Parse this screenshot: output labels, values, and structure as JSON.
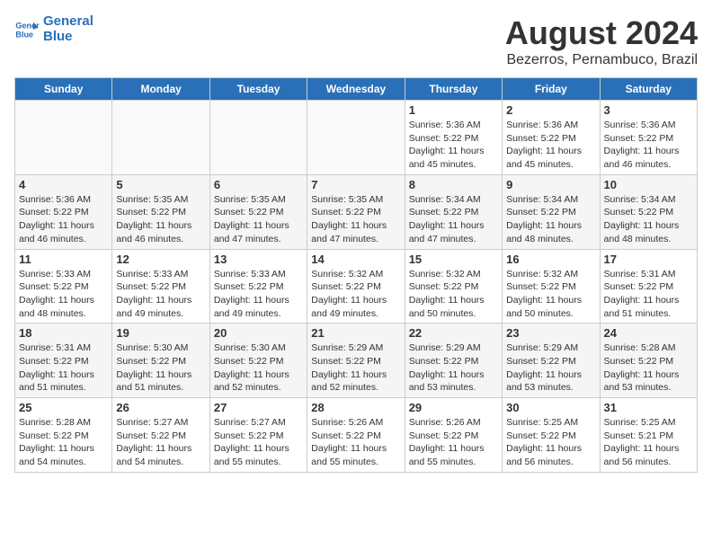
{
  "logo": {
    "line1": "General",
    "line2": "Blue"
  },
  "title": "August 2024",
  "subtitle": "Bezerros, Pernambuco, Brazil",
  "weekdays": [
    "Sunday",
    "Monday",
    "Tuesday",
    "Wednesday",
    "Thursday",
    "Friday",
    "Saturday"
  ],
  "weeks": [
    [
      {
        "day": "",
        "detail": "",
        "empty": true
      },
      {
        "day": "",
        "detail": "",
        "empty": true
      },
      {
        "day": "",
        "detail": "",
        "empty": true
      },
      {
        "day": "",
        "detail": "",
        "empty": true
      },
      {
        "day": "1",
        "detail": "Sunrise: 5:36 AM\nSunset: 5:22 PM\nDaylight: 11 hours\nand 45 minutes."
      },
      {
        "day": "2",
        "detail": "Sunrise: 5:36 AM\nSunset: 5:22 PM\nDaylight: 11 hours\nand 45 minutes."
      },
      {
        "day": "3",
        "detail": "Sunrise: 5:36 AM\nSunset: 5:22 PM\nDaylight: 11 hours\nand 46 minutes."
      }
    ],
    [
      {
        "day": "4",
        "detail": "Sunrise: 5:36 AM\nSunset: 5:22 PM\nDaylight: 11 hours\nand 46 minutes."
      },
      {
        "day": "5",
        "detail": "Sunrise: 5:35 AM\nSunset: 5:22 PM\nDaylight: 11 hours\nand 46 minutes."
      },
      {
        "day": "6",
        "detail": "Sunrise: 5:35 AM\nSunset: 5:22 PM\nDaylight: 11 hours\nand 47 minutes."
      },
      {
        "day": "7",
        "detail": "Sunrise: 5:35 AM\nSunset: 5:22 PM\nDaylight: 11 hours\nand 47 minutes."
      },
      {
        "day": "8",
        "detail": "Sunrise: 5:34 AM\nSunset: 5:22 PM\nDaylight: 11 hours\nand 47 minutes."
      },
      {
        "day": "9",
        "detail": "Sunrise: 5:34 AM\nSunset: 5:22 PM\nDaylight: 11 hours\nand 48 minutes."
      },
      {
        "day": "10",
        "detail": "Sunrise: 5:34 AM\nSunset: 5:22 PM\nDaylight: 11 hours\nand 48 minutes."
      }
    ],
    [
      {
        "day": "11",
        "detail": "Sunrise: 5:33 AM\nSunset: 5:22 PM\nDaylight: 11 hours\nand 48 minutes."
      },
      {
        "day": "12",
        "detail": "Sunrise: 5:33 AM\nSunset: 5:22 PM\nDaylight: 11 hours\nand 49 minutes."
      },
      {
        "day": "13",
        "detail": "Sunrise: 5:33 AM\nSunset: 5:22 PM\nDaylight: 11 hours\nand 49 minutes."
      },
      {
        "day": "14",
        "detail": "Sunrise: 5:32 AM\nSunset: 5:22 PM\nDaylight: 11 hours\nand 49 minutes."
      },
      {
        "day": "15",
        "detail": "Sunrise: 5:32 AM\nSunset: 5:22 PM\nDaylight: 11 hours\nand 50 minutes."
      },
      {
        "day": "16",
        "detail": "Sunrise: 5:32 AM\nSunset: 5:22 PM\nDaylight: 11 hours\nand 50 minutes."
      },
      {
        "day": "17",
        "detail": "Sunrise: 5:31 AM\nSunset: 5:22 PM\nDaylight: 11 hours\nand 51 minutes."
      }
    ],
    [
      {
        "day": "18",
        "detail": "Sunrise: 5:31 AM\nSunset: 5:22 PM\nDaylight: 11 hours\nand 51 minutes."
      },
      {
        "day": "19",
        "detail": "Sunrise: 5:30 AM\nSunset: 5:22 PM\nDaylight: 11 hours\nand 51 minutes."
      },
      {
        "day": "20",
        "detail": "Sunrise: 5:30 AM\nSunset: 5:22 PM\nDaylight: 11 hours\nand 52 minutes."
      },
      {
        "day": "21",
        "detail": "Sunrise: 5:29 AM\nSunset: 5:22 PM\nDaylight: 11 hours\nand 52 minutes."
      },
      {
        "day": "22",
        "detail": "Sunrise: 5:29 AM\nSunset: 5:22 PM\nDaylight: 11 hours\nand 53 minutes."
      },
      {
        "day": "23",
        "detail": "Sunrise: 5:29 AM\nSunset: 5:22 PM\nDaylight: 11 hours\nand 53 minutes."
      },
      {
        "day": "24",
        "detail": "Sunrise: 5:28 AM\nSunset: 5:22 PM\nDaylight: 11 hours\nand 53 minutes."
      }
    ],
    [
      {
        "day": "25",
        "detail": "Sunrise: 5:28 AM\nSunset: 5:22 PM\nDaylight: 11 hours\nand 54 minutes."
      },
      {
        "day": "26",
        "detail": "Sunrise: 5:27 AM\nSunset: 5:22 PM\nDaylight: 11 hours\nand 54 minutes."
      },
      {
        "day": "27",
        "detail": "Sunrise: 5:27 AM\nSunset: 5:22 PM\nDaylight: 11 hours\nand 55 minutes."
      },
      {
        "day": "28",
        "detail": "Sunrise: 5:26 AM\nSunset: 5:22 PM\nDaylight: 11 hours\nand 55 minutes."
      },
      {
        "day": "29",
        "detail": "Sunrise: 5:26 AM\nSunset: 5:22 PM\nDaylight: 11 hours\nand 55 minutes."
      },
      {
        "day": "30",
        "detail": "Sunrise: 5:25 AM\nSunset: 5:22 PM\nDaylight: 11 hours\nand 56 minutes."
      },
      {
        "day": "31",
        "detail": "Sunrise: 5:25 AM\nSunset: 5:21 PM\nDaylight: 11 hours\nand 56 minutes."
      }
    ]
  ]
}
